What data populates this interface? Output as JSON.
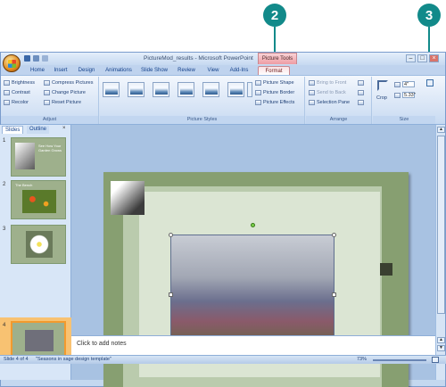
{
  "callouts": {
    "first": "2",
    "second": "3"
  },
  "titlebar": {
    "title": "PictureMod_results - Microsoft PowerPoint",
    "context_label": "Picture Tools"
  },
  "tabs": [
    "Home",
    "Insert",
    "Design",
    "Animations",
    "Slide Show",
    "Review",
    "View",
    "Add-Ins",
    "Format"
  ],
  "ribbon": {
    "adjust": {
      "label": "Adjust",
      "brightness": "Brightness",
      "contrast": "Contrast",
      "recolor": "Recolor",
      "compress": "Compress Pictures",
      "change": "Change Picture",
      "reset": "Reset Picture"
    },
    "styles": {
      "label": "Picture Styles",
      "shape": "Picture Shape",
      "border": "Picture Border",
      "effects": "Picture Effects"
    },
    "arrange": {
      "label": "Arrange",
      "front": "Bring to Front",
      "back": "Send to Back",
      "pane": "Selection Pane"
    },
    "size": {
      "label": "Size",
      "crop": "Crop",
      "height": "4\"",
      "width": "5.33\""
    }
  },
  "panes": {
    "slides_tab": "Slides",
    "outline_tab": "Outline",
    "close": "×",
    "numbers": [
      "1",
      "2",
      "3",
      "4"
    ],
    "slide2_title": "The Bench",
    "slide1_text": "See How Your Garden Grows"
  },
  "notes": {
    "placeholder": "Click to add notes"
  },
  "status": {
    "slide": "Slide 4 of 4",
    "theme": "\"Seasons in sage design template\"",
    "zoom": "73%"
  }
}
